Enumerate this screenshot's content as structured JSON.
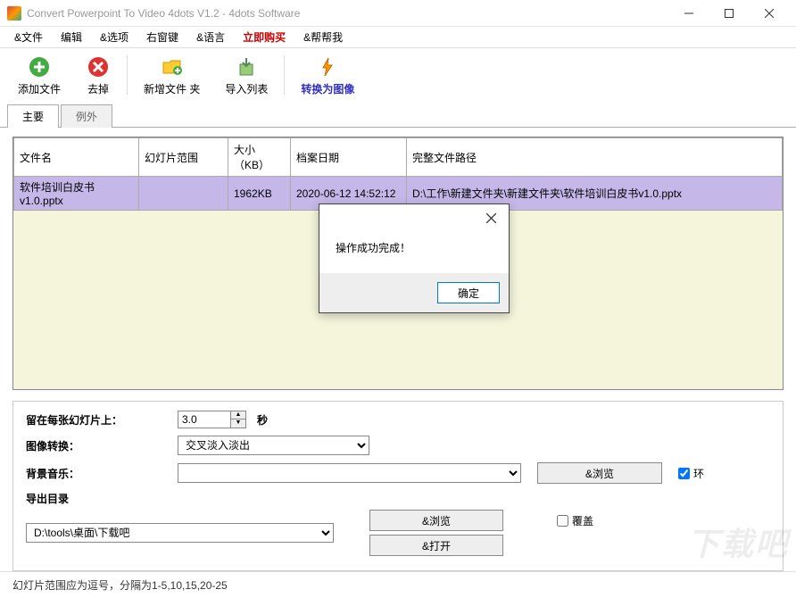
{
  "window": {
    "title": "Convert Powerpoint To Video 4dots V1.2 - 4dots Software"
  },
  "menu": {
    "file": "&文件",
    "edit": "编辑",
    "options": "&选项",
    "rightkey": "右窗键",
    "language": "&语言",
    "buy": "立即购买",
    "help": "&帮帮我"
  },
  "toolbar": {
    "add": "添加文件",
    "remove": "去掉",
    "newfolder": "新增文件 夹",
    "importlist": "导入列表",
    "toimage": "转换为图像"
  },
  "tabs": {
    "main": "主要",
    "exception": "例外"
  },
  "table": {
    "headers": {
      "name": "文件名",
      "range": "幻灯片范围",
      "size": "大小（KB）",
      "date": "档案日期",
      "path": "完整文件路径"
    },
    "rows": [
      {
        "name": "软件培训白皮书v1.0.pptx",
        "range": "",
        "size": "1962KB",
        "date": "2020-06-12 14:52:12",
        "path": "D:\\工作\\新建文件夹\\新建文件夹\\软件培训白皮书v1.0.pptx"
      }
    ]
  },
  "settings": {
    "stay_label": "留在每张幻灯片上：",
    "stay_value": "3.0",
    "stay_unit": "秒",
    "transition_label": "图像转换：",
    "transition_value": "交叉淡入淡出",
    "bgm_label": "背景音乐：",
    "bgm_value": "",
    "browse": "&浏览",
    "loop": "环",
    "export_label": "导出目录",
    "export_value": "D:\\tools\\桌面\\下载吧",
    "open": "&打开",
    "overwrite": "覆盖"
  },
  "dialog": {
    "message": "操作成功完成！",
    "ok": "确定"
  },
  "status": {
    "hint": "幻灯片范围应为逗号，分隔为1-5,10,15,20-25"
  },
  "watermark": "下载吧"
}
